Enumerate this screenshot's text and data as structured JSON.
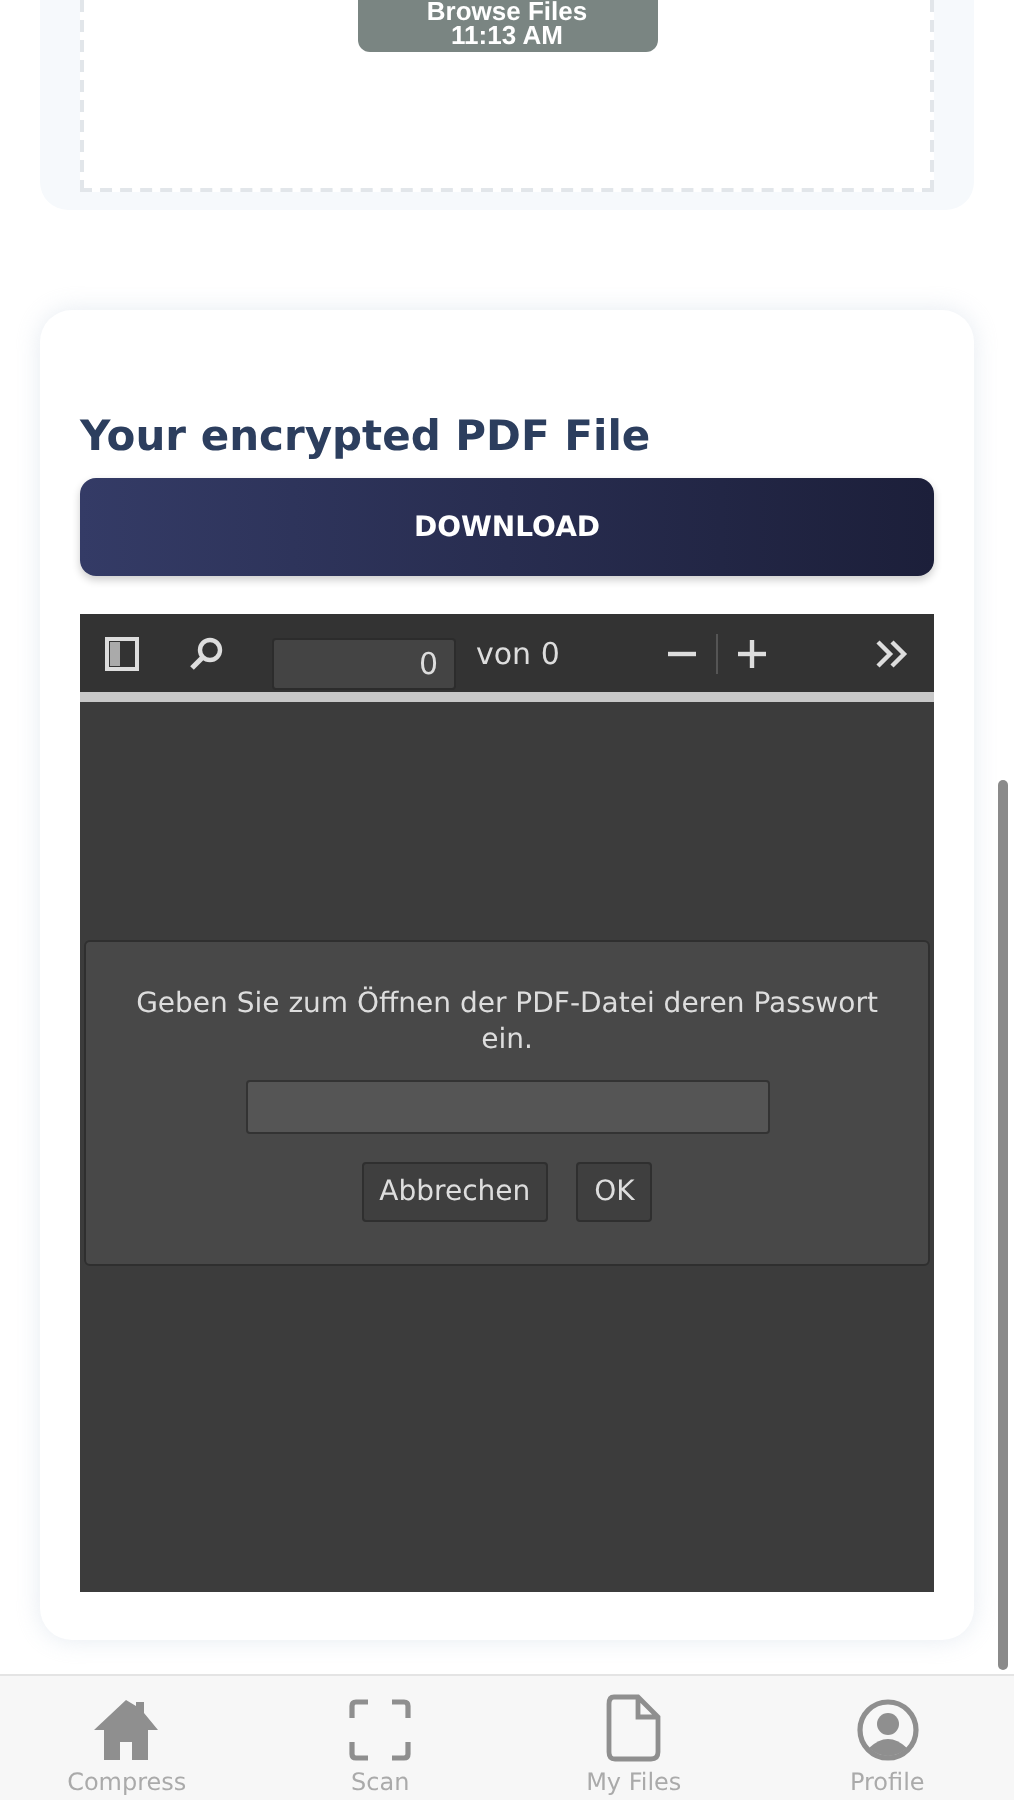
{
  "upload": {
    "button": "Browse Files",
    "time": "11:13 AM"
  },
  "result": {
    "title": "Your encrypted PDF File",
    "download": "DOWNLOAD"
  },
  "viewer": {
    "page": "0",
    "of": "von 0",
    "dialog": {
      "message": "Geben Sie zum Öffnen der PDF-Datei deren Passwort ein.",
      "buttons": [
        "Abbrechen",
        "OK"
      ]
    }
  },
  "tabs": [
    {
      "label": "Compress",
      "selected": false
    },
    {
      "label": "Scan",
      "selected": false
    },
    {
      "label": "My Files",
      "selected": false
    },
    {
      "label": "Profile",
      "selected": false
    }
  ]
}
